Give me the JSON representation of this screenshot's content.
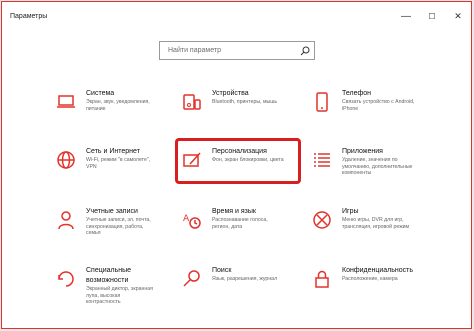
{
  "window": {
    "title": "Параметры",
    "minimize_glyph": "—",
    "maximize_glyph": "☐",
    "close_glyph": "✕"
  },
  "search": {
    "placeholder": "Найти параметр"
  },
  "accent_color": "#e3322b",
  "highlight_color": "#d81e1e",
  "categories": [
    {
      "name": "Система",
      "desc": [
        "Экран, звук, уведомления,",
        "питание"
      ],
      "icon": "laptop-icon"
    },
    {
      "name": "Устройства",
      "desc": [
        "Bluetooth, принтеры, мышь"
      ],
      "icon": "devices-icon"
    },
    {
      "name": "Телефон",
      "desc": [
        "Связать устройство с Android,",
        "iPhone"
      ],
      "icon": "phone-icon"
    },
    {
      "name": "Сеть и Интернет",
      "desc": [
        "Wi-Fi, режим \"в самолете\",",
        "VPN"
      ],
      "icon": "globe-icon"
    },
    {
      "name": "Персонализация",
      "desc": [
        "Фон, экран блокировки, цвета"
      ],
      "icon": "personalization-icon"
    },
    {
      "name": "Приложения",
      "desc": [
        "Удаление, значения по",
        "умолчанию, дополнительные",
        "компоненты"
      ],
      "icon": "apps-icon"
    },
    {
      "name": "Учетные записи",
      "desc": [
        "Учетные записи, эл. почта,",
        "синхронизация, работа,",
        "семья"
      ],
      "icon": "person-icon"
    },
    {
      "name": "Время и язык",
      "desc": [
        "Распознавание голоса,",
        "регион, дата"
      ],
      "icon": "time-language-icon"
    },
    {
      "name": "Игры",
      "desc": [
        "Меню игры, DVR для игр,",
        "трансляция, игровой режим"
      ],
      "icon": "xbox-icon"
    },
    {
      "name": "Специальные возможности",
      "desc": [
        "Экранный диктор, экранная",
        "лупа, высокая",
        "контрастность"
      ],
      "icon": "ease-of-access-icon"
    },
    {
      "name": "Поиск",
      "desc": [
        "Язык, разрешения, журнал"
      ],
      "icon": "search-category-icon"
    },
    {
      "name": "Конфиденциальность",
      "desc": [
        "Расположение, камера"
      ],
      "icon": "lock-icon"
    }
  ]
}
